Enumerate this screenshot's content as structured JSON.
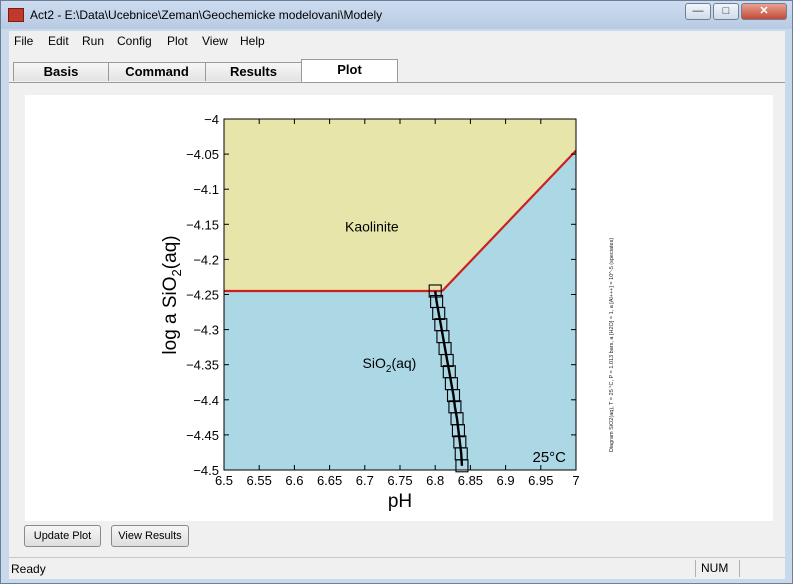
{
  "window": {
    "title": "Act2 - E:\\Data\\Ucebnice\\Zeman\\Geochemicke modelovani\\Modely",
    "minimize_glyph": "—",
    "maximize_glyph": "□",
    "close_glyph": "✕"
  },
  "menu": [
    "File",
    "Edit",
    "Run",
    "Config",
    "Plot",
    "View",
    "Help"
  ],
  "tabs": [
    "Basis",
    "Command",
    "Results",
    "Plot"
  ],
  "active_tab": "Plot",
  "buttons": {
    "update_plot": "Update Plot",
    "view_results": "View Results"
  },
  "status": {
    "text": "Ready",
    "num": "NUM"
  },
  "chart_data": {
    "type": "area",
    "xlabel": "pH",
    "ylabel_main": "log a SiO",
    "ylabel_sub": "2",
    "ylabel_tail": "(aq)",
    "xlim": [
      6.5,
      7
    ],
    "ylim": [
      -4.5,
      -4
    ],
    "x_ticks": [
      6.5,
      6.55,
      6.6,
      6.65,
      6.7,
      6.75,
      6.8,
      6.85,
      6.9,
      6.95,
      7
    ],
    "x_tick_labels": [
      "6.5",
      "6.55",
      "6.6",
      "6.65",
      "6.7",
      "6.75",
      "6.8",
      "6.85",
      "6.9",
      "6.95",
      "7"
    ],
    "y_ticks": [
      -4,
      -4.05,
      -4.1,
      -4.15,
      -4.2,
      -4.25,
      -4.3,
      -4.35,
      -4.4,
      -4.45,
      -4.5
    ],
    "y_tick_labels": [
      "−4",
      "−4.05",
      "−4.1",
      "−4.15",
      "−4.2",
      "−4.25",
      "−4.3",
      "−4.35",
      "−4.4",
      "−4.45",
      "−4.5"
    ],
    "regions": [
      {
        "label": "Kaolinite",
        "color": "#e7e5a9",
        "polygon": [
          [
            6.5,
            -4.0
          ],
          [
            7.0,
            -4.0
          ],
          [
            7.0,
            -4.045
          ],
          [
            6.81,
            -4.245
          ],
          [
            6.5,
            -4.245
          ]
        ],
        "label_at": [
          6.71,
          -4.16
        ]
      },
      {
        "label_main": "SiO",
        "label_sub": "2",
        "label_tail": "(aq)",
        "color": "#acd8e6",
        "polygon": [
          [
            6.5,
            -4.245
          ],
          [
            6.81,
            -4.245
          ],
          [
            7.0,
            -4.045
          ],
          [
            7.0,
            -4.5
          ],
          [
            6.5,
            -4.5
          ]
        ],
        "label_at": [
          6.735,
          -4.355
        ]
      }
    ],
    "boundaries": {
      "color": "#cc1f1f",
      "lines": [
        [
          [
            6.5,
            -4.245
          ],
          [
            6.81,
            -4.245
          ]
        ],
        [
          [
            6.81,
            -4.245
          ],
          [
            7.0,
            -4.045
          ]
        ]
      ]
    },
    "reaction_path": {
      "color": "#000000",
      "points": [
        [
          6.8,
          -4.245
        ],
        [
          6.802,
          -4.26
        ],
        [
          6.805,
          -4.277
        ],
        [
          6.808,
          -4.293
        ],
        [
          6.811,
          -4.31
        ],
        [
          6.814,
          -4.327
        ],
        [
          6.817,
          -4.344
        ],
        [
          6.82,
          -4.36
        ],
        [
          6.823,
          -4.377
        ],
        [
          6.826,
          -4.394
        ],
        [
          6.828,
          -4.41
        ],
        [
          6.831,
          -4.427
        ],
        [
          6.833,
          -4.444
        ],
        [
          6.835,
          -4.46
        ],
        [
          6.837,
          -4.477
        ],
        [
          6.838,
          -4.494
        ]
      ]
    },
    "temperature_label": "25°C",
    "side_caption": "Diagram SiO2(aq), T = 25 °C, P = 1.013 bars, a [H2O] = 1, a [Al+++] = 10^-5 (speciates)"
  }
}
